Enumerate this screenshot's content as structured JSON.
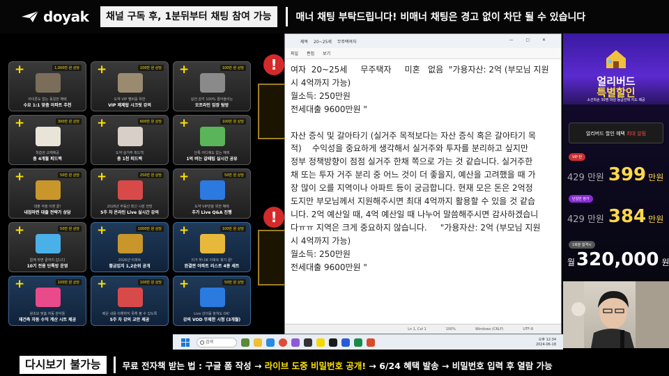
{
  "header": {
    "logo_text": "doyak",
    "channel_notice": "채널 구독 후, 1분뒤부터 채팅 참여 가능",
    "manner_notice": "매너 채팅 부탁드립니다! 비매너 채팅은 경고 없이 차단 될 수 있습니다"
  },
  "notepad": {
    "tabs": [
      "제목",
      "20~25세",
      "무주택여자"
    ],
    "menu": [
      "파일",
      "편집",
      "보기"
    ],
    "lines": [
      "여자  20~25세     무주택자     미혼   없음  \"가용자산: 2억 (부모님 지원",
      "시 4억까지 가능)",
      "월소득: 250만원",
      "전세대출 9600만원 \"",
      "",
      "자산 증식 및 갈아타기 (실거주 목적보다는 자산 증식 혹은 갈아타기 목",
      "적)    수익성을 중요하게 생각해서 실거주와 투자를 분리하고 싶지만",
      "정부 정책방향이 점점 실거주 한채 쪽으로 가는 것 같습니다. 실거주한",
      "채 또는 투자 거주 분리 중 어느 것이 더 좋을지, 예산을 고려했을 때 가",
      "장 많이 오를 지역이나 아파트 등이 궁금합니다. 현재 모은 돈은 2억정",
      "도지만 부모님께서 지원해주시면 최대 4억까지 활용할 수 있을 것 같습",
      "니다. 2억 예산일 때, 4억 예산일 때 나누어 말씀해주시면 감사하겠습니",
      "다ㅠㅠ 지역은 크게 중요하지 않습니다.     \"가용자산: 2억 (부모님 지원",
      "시 4억까지 가능)",
      "월소득: 250만원",
      "전세대출 9600만원 \""
    ],
    "status": [
      "Ln 1, Col 1",
      "100%",
      "Windows (CRLF)",
      "UTF-8"
    ]
  },
  "cards": [
    {
      "price": "1,000만 원 상당",
      "line1": "아이폰도 없는 동일한 혜택",
      "line2": "수요 1:1 맞춤 아파트 추천",
      "style": "dark",
      "icon": "#7a6e5a"
    },
    {
      "price": "100만 원 상당",
      "line1": "도약 VIP 멤버를 위한",
      "line2": "VIP 제제탑 시크릿 강의",
      "style": "dark",
      "icon": "#9a8a70"
    },
    {
      "price": "100만 원 상당",
      "line1": "실전 감각 100% 끌어올리는",
      "line2": "오프라인 임장 탐방",
      "style": "dark",
      "icon": "#8a8a8a"
    },
    {
      "price": "300만 원 상당",
      "line1": "학습권 교재제공",
      "line2": "총 4개월 피드백",
      "style": "dark",
      "icon": "#e8e4d8"
    },
    {
      "price": "600만 원 상당",
      "line1": "도약 실거주 피드백",
      "line2": "총 1천 피드백",
      "style": "dark",
      "icon": "#d8d0c8"
    },
    {
      "price": "100만 원 상당",
      "line1": "단톡 어디에도 없는 혜택",
      "line2": "1억 버는 갈때팁 실시간 공유",
      "style": "dark",
      "icon": "#5ab45a"
    },
    {
      "price": "50만 원 상당",
      "line1": "대출 걱정 이젠 끝!",
      "line2": "내집마련 대출 전략가 상담",
      "style": "dark",
      "icon": "#c8962a"
    },
    {
      "price": "250만 원 상당",
      "line1": "2026년 부동산 최신 시장 전망",
      "line2": "5주 차 온라인 Live 실시간 강의",
      "style": "dark",
      "icon": "#d84a4a"
    },
    {
      "price": "50만 원 상당",
      "line1": "도약 VIP만을 위한 혜택",
      "line2": "추가 Live Q&A 진행",
      "style": "dark",
      "icon": "#2a7ae0"
    },
    {
      "price": "50만 원 상당",
      "line1": "함께 하면 끝까지 갑니다",
      "line2": "10기 전용 단톡방 운영",
      "style": "dark",
      "icon": "#4ab0e8"
    },
    {
      "price": "1000만 원 상당",
      "line1": "2026년 아파트",
      "line2": "황금입지 1,2순위 공개",
      "style": "blue",
      "icon": "#c8962a"
    },
    {
      "price": "100만 원 상당",
      "line1": "이거 하나로 아파트 찾기 끝!",
      "line2": "완결판 아파트 리스트 4종 세트",
      "style": "blue",
      "icon": "#e8b83a"
    },
    {
      "price": "100만 원 상당",
      "line1": "왕초보 맞춤 자동 분석툴",
      "line2": "재건축 자동 수익 계산 시트 제공",
      "style": "blue",
      "icon": "#e84a8a"
    },
    {
      "price": "100만 원 상당",
      "line1": "배운 내용 이해하지 못해 볼 수 있도록",
      "line2": "5주 차 강의 교안 제공",
      "style": "blue",
      "icon": "#d84a4a"
    },
    {
      "price": "50만 원 상당",
      "line1": "Live 강의를 놓쳐도 OK!",
      "line2": "강의 VOD 무제한 시청 (3개월)",
      "style": "blue",
      "icon": "#2a7ae0"
    }
  ],
  "promo": {
    "early_title1": "얼리버드",
    "early_title2": "특별할인",
    "early_note": "소선착순 30명 마감 등급선택 지도 제공",
    "benefit_text": "얼리버드 할인 혜택",
    "benefit_red": "최대 알림",
    "tier1": {
      "tag": "VIP 반",
      "old": "429 만원",
      "new": "399",
      "unit": "만원",
      "color": "#c83232"
    },
    "tier2": {
      "tag": "단일반 정가",
      "old": "429 만원",
      "new": "384",
      "unit": "만원",
      "color": "#8a2ad8"
    },
    "tier3": {
      "tag": "1회분 합격시",
      "prefix": "월",
      "amount": "320,000",
      "unit": "원",
      "color": "#555555"
    }
  },
  "taskbar": {
    "search_placeholder": "검색",
    "time": "오후 12:34",
    "date": "2024-06-18"
  },
  "footer": {
    "replay": "다시보기 불가능",
    "ticker_a": "무료 전자책 받는 법 : 구글 폼 작성 → ",
    "ticker_b": "라이브 도중 비밀번호 공개!",
    "ticker_c": " → 6/24 혜택 발송 → 비밀번호 입력 후 열람 가능"
  }
}
